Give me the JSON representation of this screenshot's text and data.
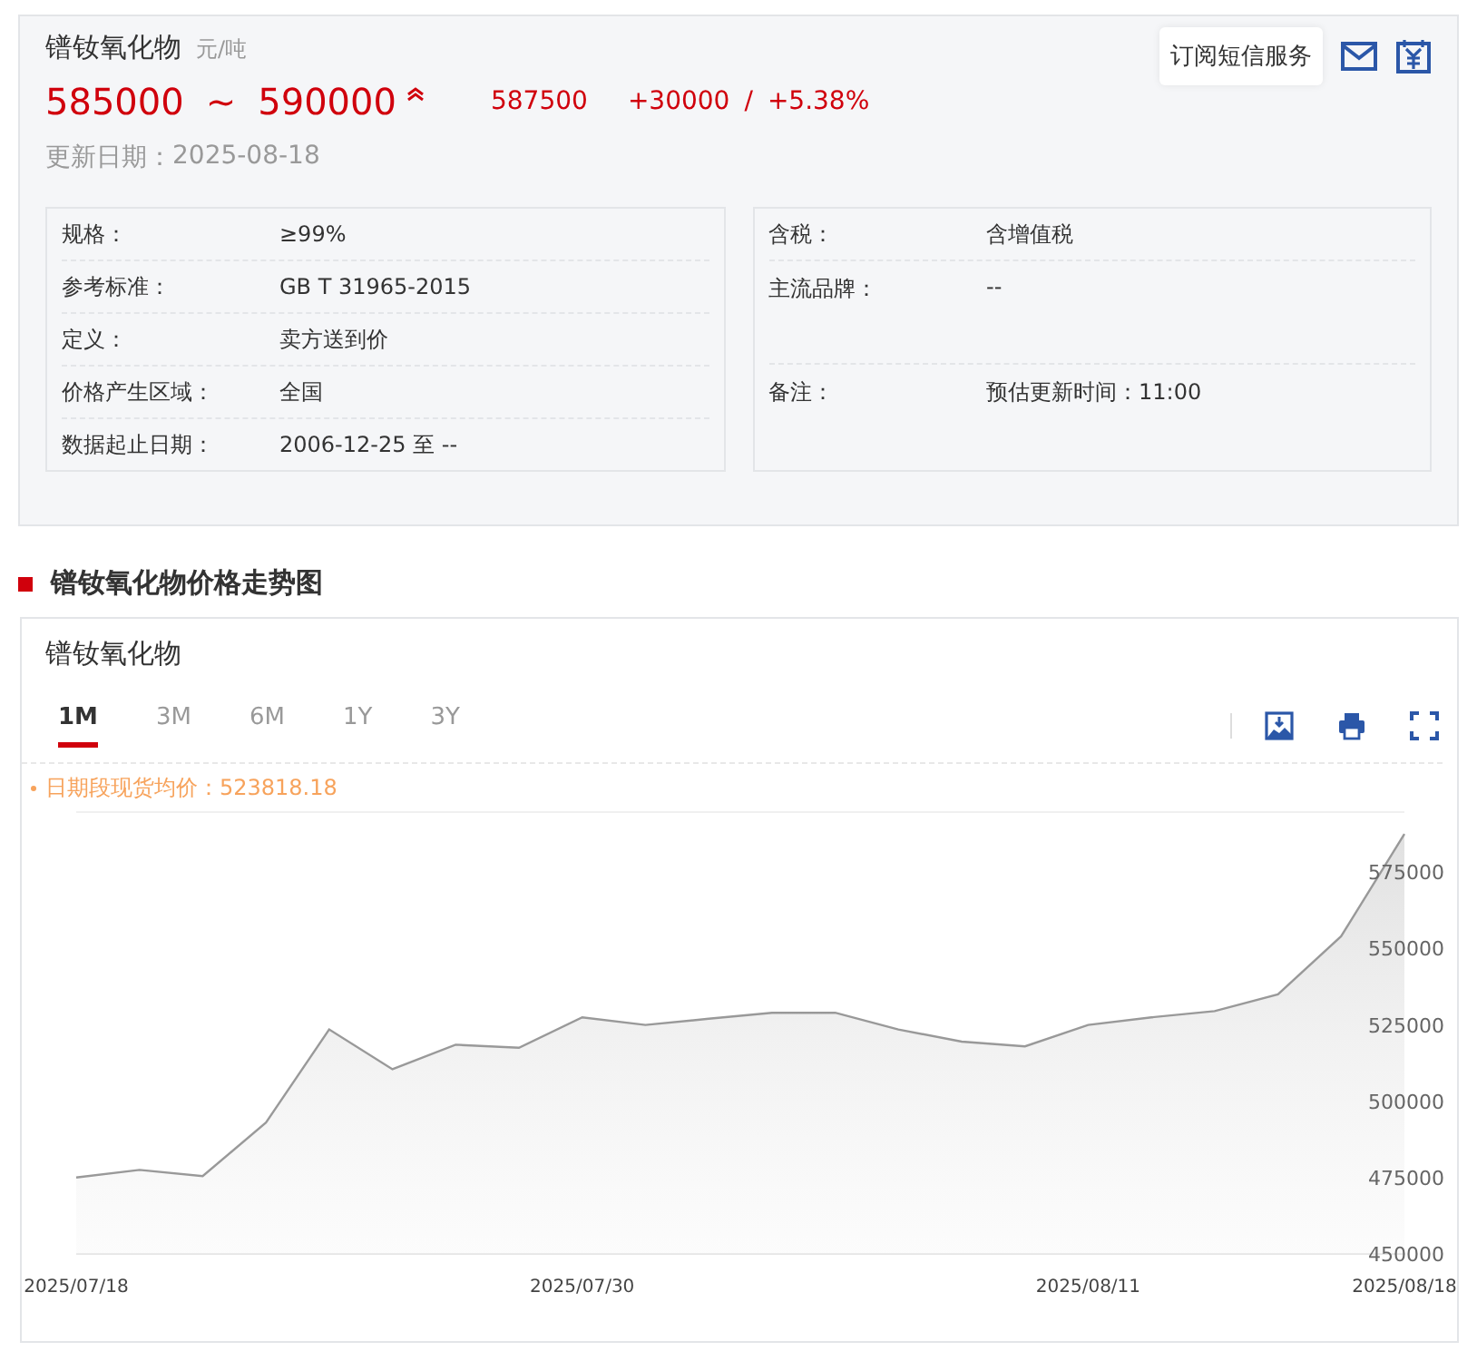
{
  "product": {
    "name": "镨钕氧化物",
    "unit": "元/吨",
    "price_low": "585000",
    "separator": "~",
    "price_high": "590000",
    "rising": true,
    "average": "587500",
    "change": "+30000",
    "change_separator": "/",
    "change_pct": "+5.38%",
    "updated_label": "更新日期：",
    "updated_date": "2025-08-18",
    "subscribe_button": "订阅短信服务"
  },
  "specs_left": [
    {
      "label": "规格：",
      "value": "≥99%"
    },
    {
      "label": "参考标准：",
      "value": "GB T 31965-2015"
    },
    {
      "label": "定义：",
      "value": "卖方送到价"
    },
    {
      "label": "价格产生区域：",
      "value": "全国"
    },
    {
      "label": "数据起止日期：",
      "value": "2006-12-25 至 --"
    }
  ],
  "specs_right": [
    {
      "label": "含税：",
      "value": "含增值税"
    },
    {
      "label": "主流品牌：",
      "value": "--",
      "tall": true
    },
    {
      "label": "备注：",
      "value": "预估更新时间：11:00",
      "tall": true
    }
  ],
  "section_title": "镨钕氧化物价格走势图",
  "chart_panel": {
    "title": "镨钕氧化物",
    "tabs": [
      {
        "label": "1M",
        "selected": true
      },
      {
        "label": "3M",
        "selected": false
      },
      {
        "label": "6M",
        "selected": false
      },
      {
        "label": "1Y",
        "selected": false
      },
      {
        "label": "3Y",
        "selected": false
      }
    ],
    "average_label": "日期段现货均价：523818.18",
    "chart_data": {
      "type": "area",
      "categories": [
        "2025/07/18",
        null,
        null,
        null,
        null,
        null,
        null,
        null,
        "2025/07/30",
        null,
        null,
        null,
        null,
        null,
        null,
        null,
        "2025/08/11",
        null,
        null,
        null,
        null,
        "2025/08/18"
      ],
      "series": [
        {
          "color": "#999999",
          "values": [
            475000,
            477500,
            475500,
            493000,
            523500,
            510500,
            518500,
            517500,
            527500,
            525000,
            527000,
            529000,
            529000,
            523500,
            519500,
            518000,
            525000,
            527500,
            529500,
            535000,
            554000,
            587500
          ]
        }
      ],
      "ylim": [
        450000,
        595000
      ],
      "yticks": [
        450000,
        475000,
        500000,
        525000,
        550000,
        575000
      ]
    }
  }
}
